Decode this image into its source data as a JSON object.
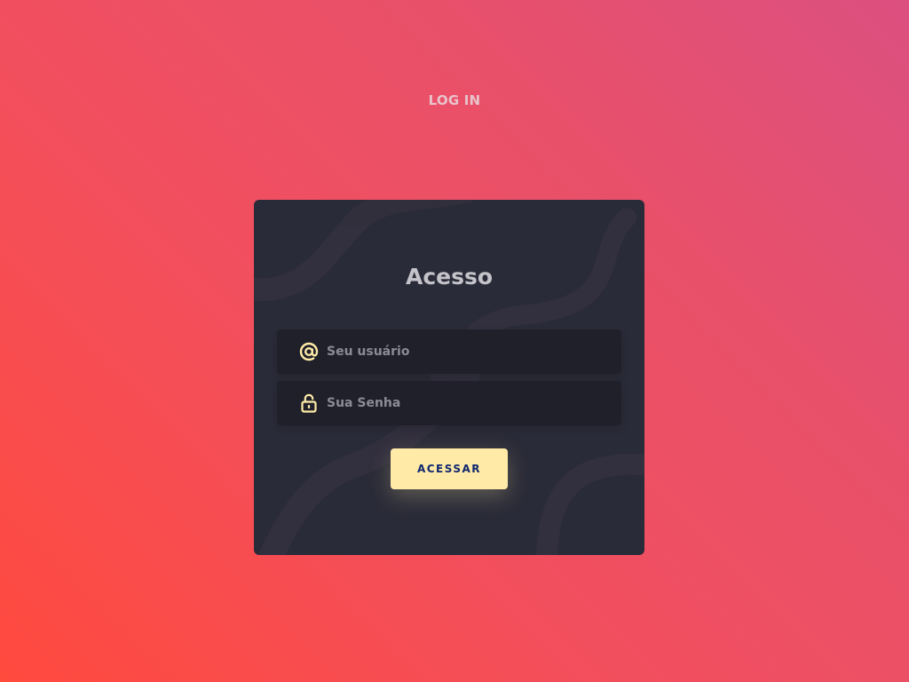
{
  "page": {
    "heading": "LOG IN"
  },
  "login_card": {
    "title": "Acesso",
    "username": {
      "icon": "at-sign-icon",
      "placeholder": "Seu usuário",
      "value": ""
    },
    "password": {
      "icon": "lock-icon",
      "placeholder": "Sua Senha",
      "value": ""
    },
    "submit_label": "ACESSAR"
  },
  "colors": {
    "gradient_start": "#ff4a3e",
    "gradient_end": "#dc5080",
    "card_bg": "#2a2b38",
    "field_bg": "#1f2029",
    "accent": "#ffeba7",
    "button_text": "#102770"
  }
}
